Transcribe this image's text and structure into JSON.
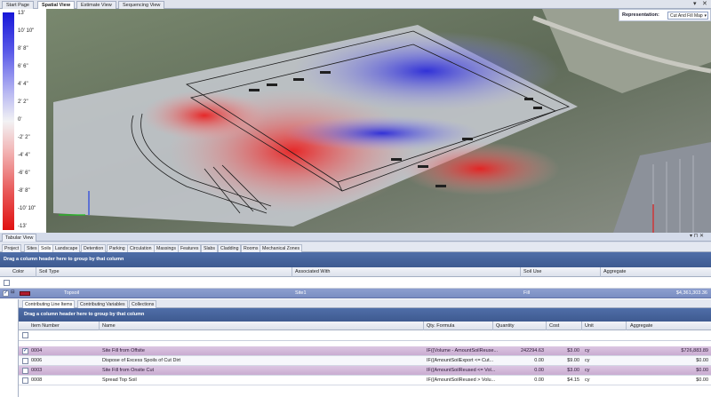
{
  "doc_tabs": [
    {
      "label": "Start Page",
      "active": false
    },
    {
      "label": "Spatial View",
      "active": true
    },
    {
      "label": "Estimate View",
      "active": false
    },
    {
      "label": "Sequencing View",
      "active": false
    }
  ],
  "window_controls": {
    "dropdown": "▾",
    "close": "✕"
  },
  "legend": {
    "labels": [
      "13'",
      "10' 10\"",
      "8' 8\"",
      "6' 6\"",
      "4' 4\"",
      "2' 2\"",
      "0'",
      "-2' 2\"",
      "-4' 4\"",
      "-6' 6\"",
      "-8' 8\"",
      "-10' 10\"",
      "-13'"
    ]
  },
  "representation": {
    "label": "Representation:",
    "value": "Cut And Fill Map",
    "arrow": "▾"
  },
  "tabular": {
    "title": "Tabular View",
    "pin": "▾ ⊓ ✕"
  },
  "tabs": [
    "Project",
    "Sites",
    "Soils",
    "Landscape",
    "Detention",
    "Parking",
    "Circulation",
    "Massings",
    "Features",
    "Slabs",
    "Cladding",
    "Rooms",
    "Mechanical Zones"
  ],
  "active_tab": "Soils",
  "grid": {
    "group_hint": "Drag a column header here to group by that column",
    "columns": [
      "Color",
      "Soil Type",
      "Associated With",
      "Soil Use",
      "Aggregate"
    ],
    "row": {
      "check": "✓",
      "expand": "⊟",
      "soil_type": "Topsoil",
      "associated_with": "Site1",
      "soil_use": "Fill",
      "aggregate": "$4,361,303.36"
    }
  },
  "detail": {
    "tabs": [
      "Contributing Line Items",
      "Contributing Variables",
      "Collections"
    ],
    "group_hint": "Drag a column header here to group by that column",
    "columns": [
      "Item Number",
      "Name",
      "Qty. Formula",
      "Quantity",
      "Cost",
      "Unit",
      "Aggregate"
    ],
    "rows": [
      {
        "check": "✓",
        "item": "0004",
        "name": "Site Fill from Offsite",
        "formula": "IF({Volume - AmountSoilReuse...",
        "quantity": "242294.63",
        "cost": "$3.00",
        "unit": "cy",
        "aggregate": "$726,883.89",
        "style": "sel"
      },
      {
        "check": "",
        "item": "0006",
        "name": "Dispose of Excess Spoils of Cut Dirt",
        "formula": "IF({AmountSoilExport <= Cut...",
        "quantity": "0.00",
        "cost": "$9.00",
        "unit": "cy",
        "aggregate": "$0.00",
        "style": "alt"
      },
      {
        "check": "",
        "item": "0003",
        "name": "Site Fill from Onsite Cut",
        "formula": "IF({AmountSoilReused <= Vol...",
        "quantity": "0.00",
        "cost": "$3.00",
        "unit": "cy",
        "aggregate": "$0.00",
        "style": "sel"
      },
      {
        "check": "",
        "item": "0008",
        "name": "Spread Top Soil",
        "formula": "IF({AmountSoilReused > Volu...",
        "quantity": "0.00",
        "cost": "$4.15",
        "unit": "cy",
        "aggregate": "$0.00",
        "style": ""
      }
    ]
  },
  "colors": {
    "fill_red": "#e01010",
    "cut_blue": "#1616d8",
    "selected_row": "#c9acd1",
    "header_blue": "#4f6ea8",
    "topsoil_swatch": "#b01b2e"
  }
}
